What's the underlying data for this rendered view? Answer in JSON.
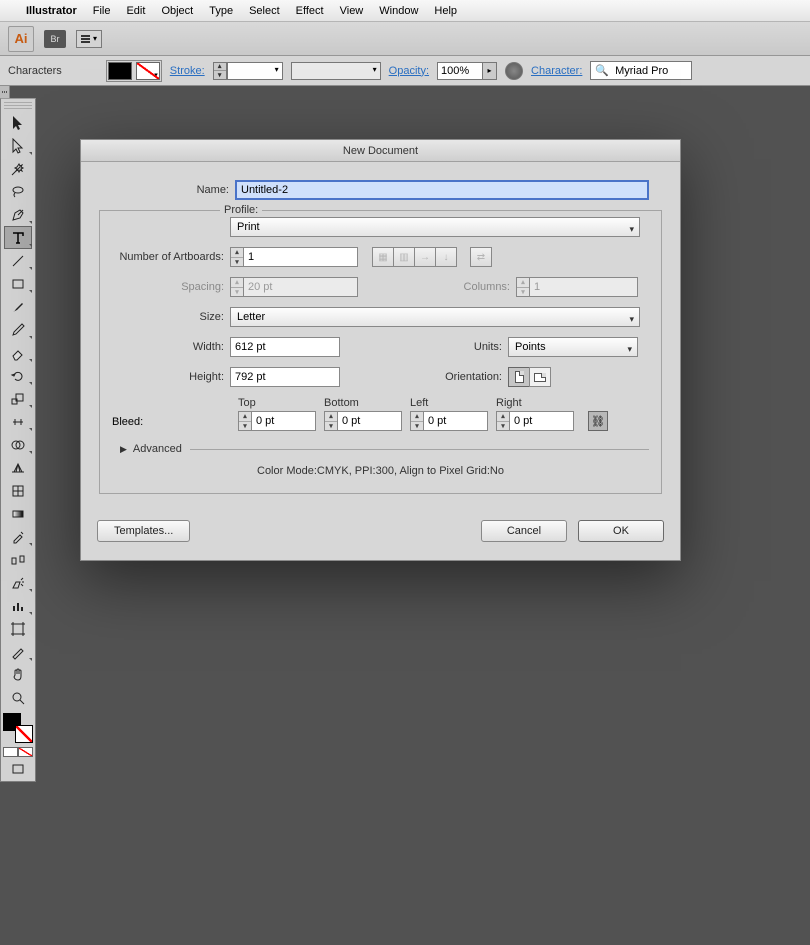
{
  "menubar": {
    "app": "Illustrator",
    "items": [
      "File",
      "Edit",
      "Object",
      "Type",
      "Select",
      "Effect",
      "View",
      "Window",
      "Help"
    ]
  },
  "appheader": {
    "ai": "Ai",
    "br": "Br"
  },
  "controlbar": {
    "mode": "Characters",
    "stroke_label": "Stroke:",
    "stroke_weight": "",
    "opacity_label": "Opacity:",
    "opacity_value": "100%",
    "character_label": "Character:",
    "font_value": "Myriad Pro"
  },
  "dialog": {
    "title": "New Document",
    "name_label": "Name:",
    "name_value": "Untitled-2",
    "profile_label": "Profile:",
    "profile_value": "Print",
    "artboards_label": "Number of Artboards:",
    "artboards_value": "1",
    "spacing_label": "Spacing:",
    "spacing_value": "20 pt",
    "columns_label": "Columns:",
    "columns_value": "1",
    "size_label": "Size:",
    "size_value": "Letter",
    "width_label": "Width:",
    "width_value": "612 pt",
    "units_label": "Units:",
    "units_value": "Points",
    "height_label": "Height:",
    "height_value": "792 pt",
    "orientation_label": "Orientation:",
    "bleed_label": "Bleed:",
    "bleed": {
      "top": "Top",
      "bottom": "Bottom",
      "left": "Left",
      "right": "Right",
      "value": "0 pt"
    },
    "advanced_label": "Advanced",
    "summary": "Color Mode:CMYK, PPI:300, Align to Pixel Grid:No",
    "templates_btn": "Templates...",
    "cancel_btn": "Cancel",
    "ok_btn": "OK"
  }
}
